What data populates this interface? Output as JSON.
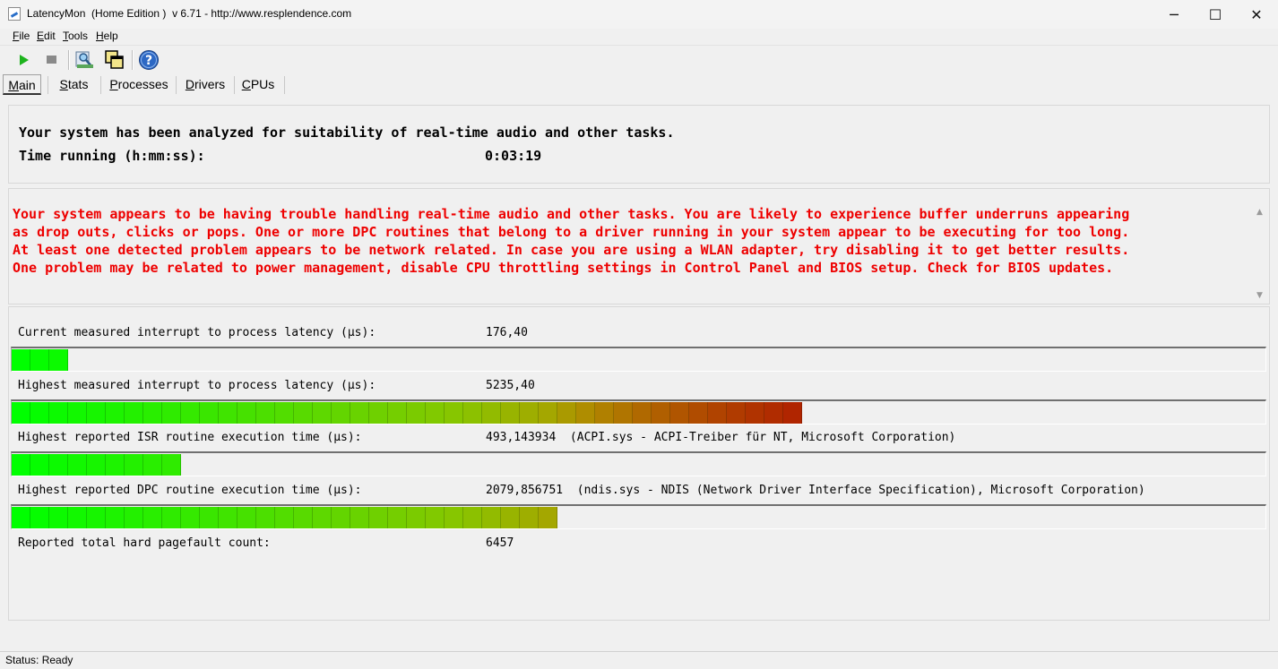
{
  "window": {
    "title": "LatencyMon  (Home Edition )  v 6.71 - http://www.resplendence.com",
    "minimize_glyph": "─",
    "maximize_glyph": "☐",
    "close_glyph": "✕"
  },
  "menu": {
    "items": [
      "File",
      "Edit",
      "Tools",
      "Help"
    ]
  },
  "toolbar": {
    "icons": [
      "play-icon",
      "stop-icon",
      "search-driver-icon",
      "windows-icon",
      "help-icon"
    ],
    "help_glyph": "?"
  },
  "tabs": {
    "items": [
      "Main",
      "Stats",
      "Processes",
      "Drivers",
      "CPUs"
    ],
    "active": "Main"
  },
  "summary": {
    "headline": "Your system has been analyzed for suitability of real-time audio and other tasks.",
    "time_label": "Time running (h:mm:ss):",
    "time_value": "0:03:19"
  },
  "verdict": {
    "lines": [
      "Your system appears to be having trouble handling real-time audio and other tasks. You are likely to experience buffer underruns appearing",
      "as drop outs, clicks or pops. One or more DPC routines that belong to a driver running in your system appear to be executing for too long.",
      "At least one detected problem appears to be network related. In case you are using a WLAN adapter, try disabling it to get better results.",
      "One problem may be related to power management, disable CPU throttling settings in Control Panel and BIOS setup. Check for BIOS updates."
    ],
    "color": "#ee0000"
  },
  "metrics": {
    "current_latency": {
      "label": "Current measured interrupt to process latency (µs):",
      "value": "176,40",
      "bar_fill_fraction": 0.043
    },
    "highest_latency": {
      "label": "Highest measured interrupt to process latency (µs):",
      "value": "5235,40",
      "bar_fill_fraction": 0.628
    },
    "highest_isr": {
      "label": "Highest reported ISR routine execution time (µs):",
      "value": "493,143934  (ACPI.sys - ACPI-Treiber für NT, Microsoft Corporation)",
      "bar_fill_fraction": 0.14
    },
    "highest_dpc": {
      "label": "Highest reported DPC routine execution time (µs):",
      "value": "2079,856751  (ndis.sys - NDIS (Network Driver Interface Specification), Microsoft Corporation)",
      "bar_fill_fraction": 0.438
    },
    "pagefault": {
      "label": "Reported total hard pagefault count:",
      "value": "6457"
    }
  },
  "colors": {
    "bar_low": "#00ff00",
    "bar_high": "#b00000"
  },
  "status": {
    "text": "Status: Ready"
  }
}
